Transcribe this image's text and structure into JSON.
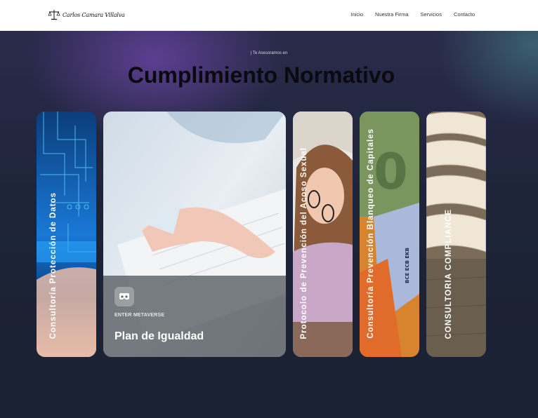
{
  "navbar": {
    "logo_text": "Carlos Camara Villalva",
    "links": [
      "Inicio",
      "Nuestra Firma",
      "Servicios",
      "Contacto"
    ]
  },
  "hero": {
    "kicker": "| Te Asesoramos en",
    "title": "Cumplimiento Normativo"
  },
  "cards": [
    {
      "label": "Consultoría Protección de Datos"
    },
    {
      "meta_label": "ENTER METAVERSE",
      "title": "Plan de Igualdad",
      "icon": "vr-headset-icon"
    },
    {
      "label": "Protocolo de Prevención del Acoso Sexual"
    },
    {
      "label": "Consultoría Prevención Blanqueo de Capitales"
    },
    {
      "label": "CONSULTORIA COMPLIANCE"
    }
  ],
  "colors": {
    "accent_dark": "#0a0a10",
    "hero_bg": "#1b2233",
    "panel": "#555a5f"
  }
}
